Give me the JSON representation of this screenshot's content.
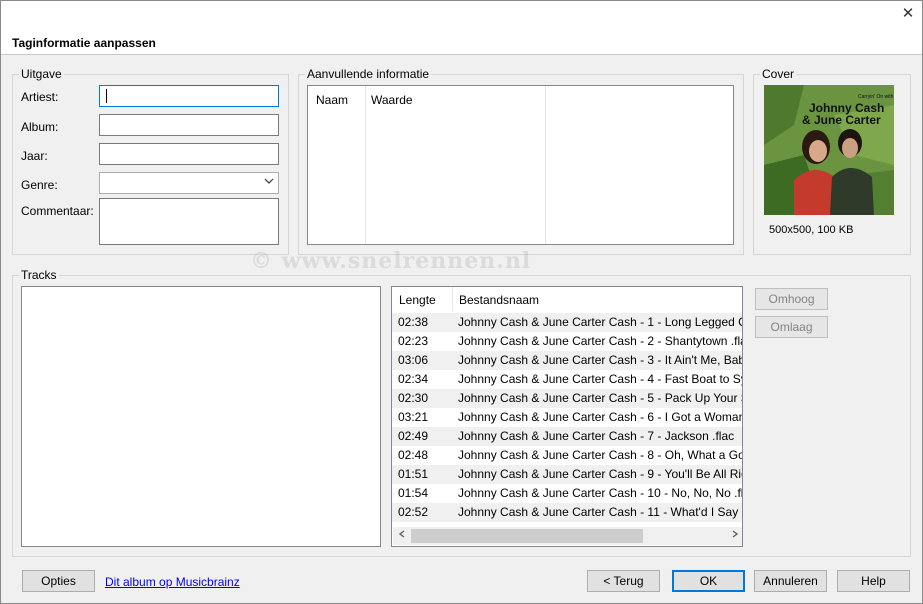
{
  "dialog": {
    "title": "Taginformatie aanpassen",
    "close_glyph": "✕"
  },
  "uitgave": {
    "legend": "Uitgave",
    "artist_label": "Artiest:",
    "artist_value": "",
    "album_label": "Album:",
    "album_value": "",
    "year_label": "Jaar:",
    "year_value": "",
    "genre_label": "Genre:",
    "genre_value": "",
    "comment_label": "Commentaar:",
    "comment_value": ""
  },
  "extra_info": {
    "legend": "Aanvullende informatie",
    "col_name": "Naam",
    "col_value": "Waarde"
  },
  "cover": {
    "legend": "Cover",
    "info": "500x500, 100 KB",
    "art_artist_line1": "Johnny Cash",
    "art_artist_line2": "& June Carter",
    "art_small_text": "Carryin' On with"
  },
  "watermark": "© www.snelrennen.nl",
  "tracks": {
    "legend": "Tracks",
    "col_length": "Lengte",
    "col_filename": "Bestandsnaam",
    "rows": [
      {
        "length": "02:38",
        "filename": "Johnny Cash & June Carter Cash - 1  - Long Legged G"
      },
      {
        "length": "02:23",
        "filename": "Johnny Cash & June Carter Cash - 2  - Shantytown .fla"
      },
      {
        "length": "03:06",
        "filename": "Johnny Cash & June Carter Cash - 3  - It Ain't Me, Bab"
      },
      {
        "length": "02:34",
        "filename": "Johnny Cash & June Carter Cash - 4  - Fast Boat to Syc"
      },
      {
        "length": "02:30",
        "filename": "Johnny Cash & June Carter Cash - 5  - Pack Up Your S"
      },
      {
        "length": "03:21",
        "filename": "Johnny Cash & June Carter Cash - 6  - I Got a Woman"
      },
      {
        "length": "02:49",
        "filename": "Johnny Cash & June Carter Cash - 7  - Jackson .flac"
      },
      {
        "length": "02:48",
        "filename": "Johnny Cash & June Carter Cash - 8  - Oh, What a Goo"
      },
      {
        "length": "01:51",
        "filename": "Johnny Cash & June Carter Cash - 9  - You'll Be All Rig"
      },
      {
        "length": "01:54",
        "filename": "Johnny Cash & June Carter Cash - 10  - No, No, No .fl"
      },
      {
        "length": "02:52",
        "filename": "Johnny Cash & June Carter Cash - 11  - What'd I Say .f"
      }
    ],
    "up_label": "Omhoog",
    "down_label": "Omlaag"
  },
  "footer": {
    "options_label": "Opties",
    "musicbrainz_link": "Dit album op Musicbrainz",
    "back_label": "< Terug",
    "ok_label": "OK",
    "cancel_label": "Annuleren",
    "help_label": "Help"
  },
  "colors": {
    "accent": "#0078d7",
    "link": "#0000ee",
    "row_alt": "#f0f0f0"
  }
}
